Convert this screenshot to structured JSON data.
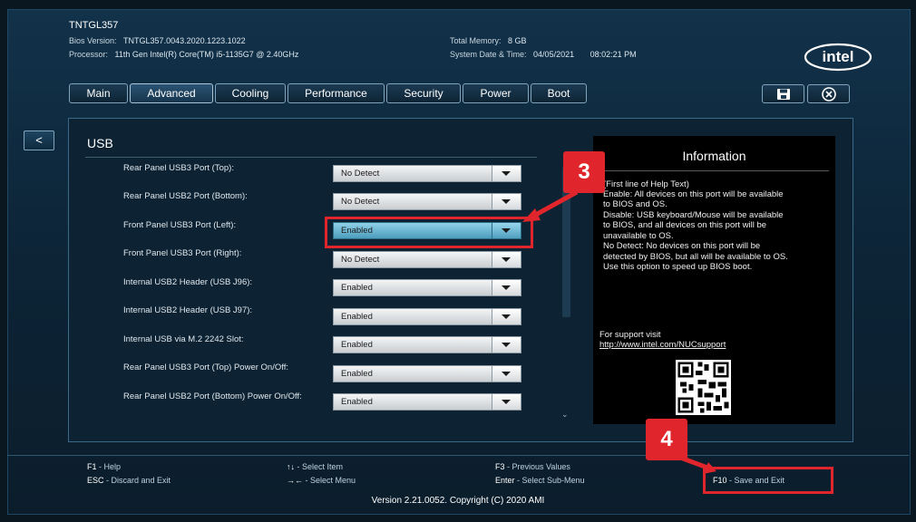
{
  "header": {
    "model": "TNTGL357",
    "bios_version_label": "Bios Version:",
    "bios_version": "TNTGL357.0043.2020.1223.1022",
    "processor_label": "Processor:",
    "processor": "11th Gen Intel(R) Core(TM) i5-1135G7 @ 2.40GHz",
    "total_memory_label": "Total Memory:",
    "total_memory": "8 GB",
    "datetime_label": "System Date & Time:",
    "date": "04/05/2021",
    "time": "08:02:21 PM",
    "logo": "intel"
  },
  "tabs": [
    {
      "label": "Main"
    },
    {
      "label": "Advanced"
    },
    {
      "label": "Cooling"
    },
    {
      "label": "Performance"
    },
    {
      "label": "Security"
    },
    {
      "label": "Power"
    },
    {
      "label": "Boot"
    }
  ],
  "toolbar": {
    "save_icon": "floppy-disk-icon",
    "exit_icon": "close-circle-icon"
  },
  "back_button": {
    "label": "<"
  },
  "section": {
    "title": "USB"
  },
  "settings": [
    {
      "label": "Rear Panel USB3 Port (Top):",
      "value": "No Detect"
    },
    {
      "label": "Rear Panel USB2 Port (Bottom):",
      "value": "No Detect"
    },
    {
      "label": "Front Panel USB3 Port (Left):",
      "value": "Enabled"
    },
    {
      "label": "Front Panel USB3 Port (Right):",
      "value": "No Detect"
    },
    {
      "label": "Internal USB2 Header (USB  J96):",
      "value": "Enabled"
    },
    {
      "label": "Internal USB2 Header (USB  J97):",
      "value": "Enabled"
    },
    {
      "label": "Internal USB via M.2 2242 Slot:",
      "value": "Enabled"
    },
    {
      "label": "Rear Panel USB3 Port (Top) Power On/Off:",
      "value": "Enabled"
    },
    {
      "label": "Rear Panel USB2 Port (Bottom) Power On/Off:",
      "value": "Enabled"
    }
  ],
  "info": {
    "title": "Information",
    "lines": [
      "(First line of Help Text)",
      "Enable: All devices on this port will be available",
      "to BIOS and OS.",
      "Disable: USB keyboard/Mouse will be available",
      "to BIOS, and all devices on this port will be",
      "unavailable to OS.",
      "No Detect: No devices on this port will be",
      "detected by BIOS, but all will be available to OS.",
      "Use this option to speed up BIOS boot."
    ],
    "support_text": "For support visit",
    "support_link": "http://www.intel.com/NUCsupport"
  },
  "footer": {
    "keys": [
      {
        "key": "F1",
        "desc": "Help"
      },
      {
        "key": "ESC",
        "desc": "Discard and Exit"
      },
      {
        "key": "↑↓",
        "desc": "Select Item"
      },
      {
        "key": "→←",
        "desc": "Select Menu"
      },
      {
        "key": "F3",
        "desc": "Previous Values"
      },
      {
        "key": "Enter",
        "desc": "Select Sub-Menu"
      },
      {
        "key": "F10",
        "desc": "Save and Exit"
      }
    ],
    "version": "Version 2.21.0052. Copyright (C) 2020 AMI"
  },
  "callouts": [
    {
      "number": "3"
    },
    {
      "number": "4"
    }
  ],
  "colors": {
    "callout": "#e0262c",
    "selected_dropdown": "#6bb8d6",
    "background": "#0d2538"
  }
}
